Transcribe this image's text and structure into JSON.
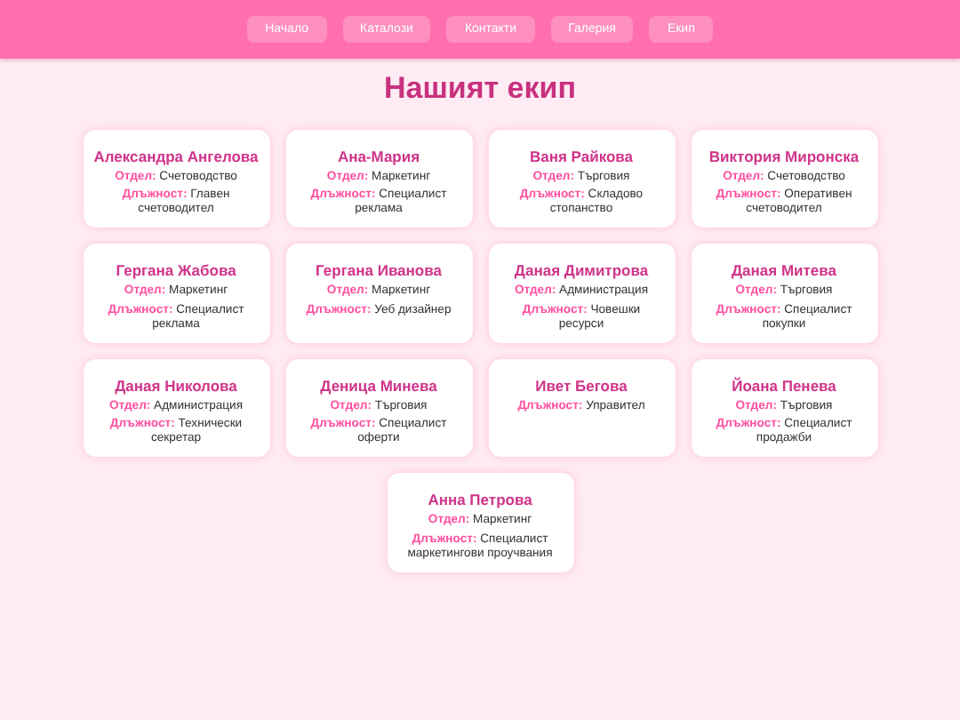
{
  "nav": [
    "Начало",
    "Каталози",
    "Контакти",
    "Галерия",
    "Екип"
  ],
  "title": "Нашият екип",
  "members": [
    {
      "name": "Александра Ангелова",
      "details": [
        "**Отдел:** Счетоводство",
        "**Длъжност:** Главен счетоводител"
      ]
    },
    {
      "name": "Ана-Мария",
      "details": [
        "**Отдел:** Маркетинг",
        "**Длъжност:** Специалист реклама"
      ]
    },
    {
      "name": "Ваня Райкова",
      "details": [
        "**Отдел:** Търговия",
        "**Длъжност:** Складово стопанство"
      ]
    },
    {
      "name": "Виктория Миронска",
      "details": [
        "**Отдел:** Счетоводство",
        "**Длъжност:** Оперативен счетоводител"
      ]
    },
    {
      "name": "Гергана Жабова",
      "details": [
        "**Отдел:** Маркетинг",
        "**Длъжност:** Специалист реклама"
      ]
    },
    {
      "name": "Гергана Иванова",
      "details": [
        "**Отдел:** Маркетинг",
        "**Длъжност:** Уеб дизайнер"
      ]
    },
    {
      "name": "Даная Димитрова",
      "details": [
        "**Отдел:** Администрация",
        "**Длъжност:** Човешки ресурси"
      ]
    },
    {
      "name": "Даная Митева",
      "details": [
        "**Отдел:** Търговия",
        "**Длъжност:** Специалист покупки"
      ]
    },
    {
      "name": "Даная Николова",
      "details": [
        "**Отдел:** Администрация",
        "**Длъжност:** Технически секретар"
      ]
    },
    {
      "name": "Деница Минева",
      "details": [
        "**Отдел:** Търговия",
        "**Длъжност:** Специалист оферти"
      ]
    },
    {
      "name": "Ивет Бегова",
      "details": [
        "**Длъжност:** Управител"
      ]
    },
    {
      "name": "Йоана Пенева",
      "details": [
        "**Отдел:** Търговия",
        "**Длъжност:** Специалист продажби"
      ]
    },
    {
      "name": "Анна Петрова",
      "details": [
        "**Отдел:** Маркетинг",
        "**Длъжност:** Специалист маркетингови проучвания"
      ]
    }
  ]
}
